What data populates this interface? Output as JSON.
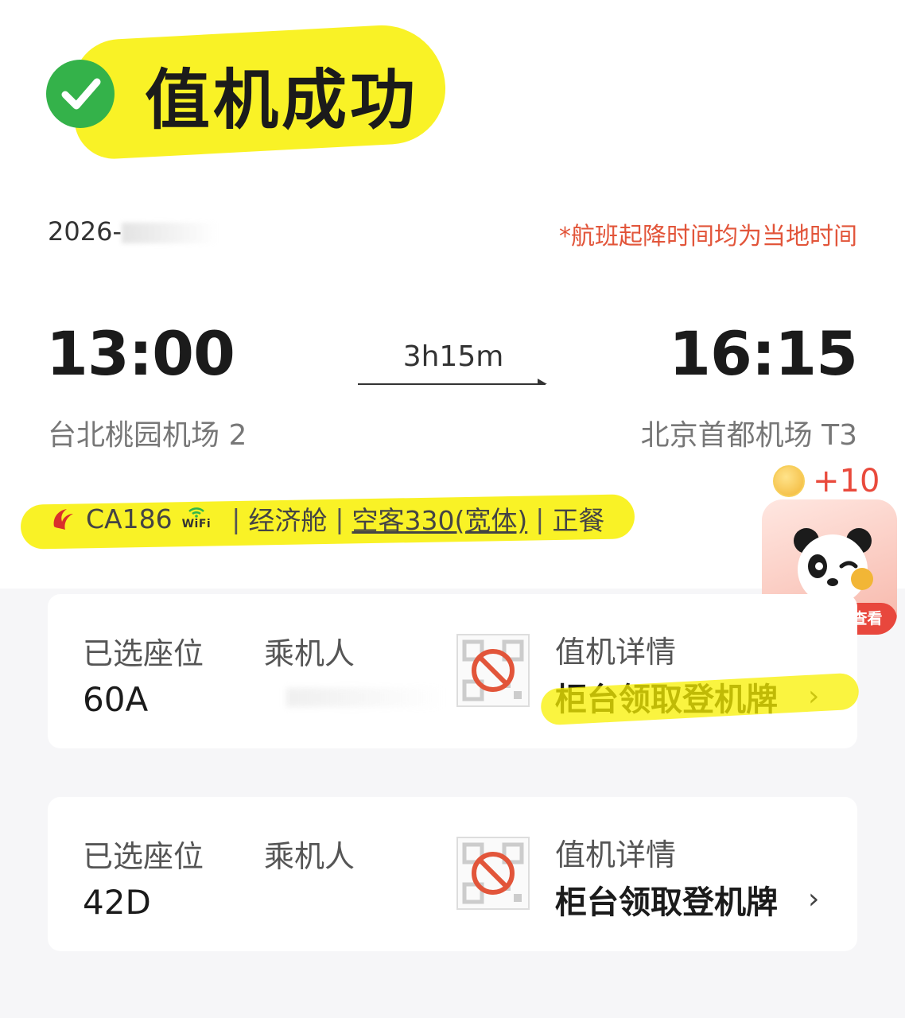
{
  "status": {
    "title": "值机成功"
  },
  "date": "2026-",
  "tz_note": "*航班起降时间均为当地时间",
  "departure": {
    "time": "13:00",
    "airport": "台北桃园机场 2"
  },
  "arrival": {
    "time": "16:15",
    "airport": "北京首都机场 T3"
  },
  "duration": "3h15m",
  "flight": {
    "number": "CA186",
    "wifi_label": "WiFi",
    "cabin": "经济舱",
    "aircraft": "空客330(宽体)",
    "meal": "正餐",
    "separator": "|"
  },
  "promo": {
    "coins": "+10",
    "button": "去飞行小镇查看"
  },
  "cards": [
    {
      "seat_label": "已选座位",
      "seat": "60A",
      "pax_label": "乘机人",
      "checkin_label": "值机详情",
      "checkin_value": "柜台领取登机牌"
    },
    {
      "seat_label": "已选座位",
      "seat": "42D",
      "pax_label": "乘机人",
      "checkin_label": "值机详情",
      "checkin_value": "柜台领取登机牌"
    }
  ],
  "colors": {
    "success": "#34b24a",
    "accent_red": "#e2553a",
    "highlight": "#f8f000"
  },
  "icons": {
    "status": "check-circle-icon",
    "airline": "airline-logo-icon",
    "qr": "qr-disabled-icon",
    "chevron": "chevron-right-icon"
  }
}
